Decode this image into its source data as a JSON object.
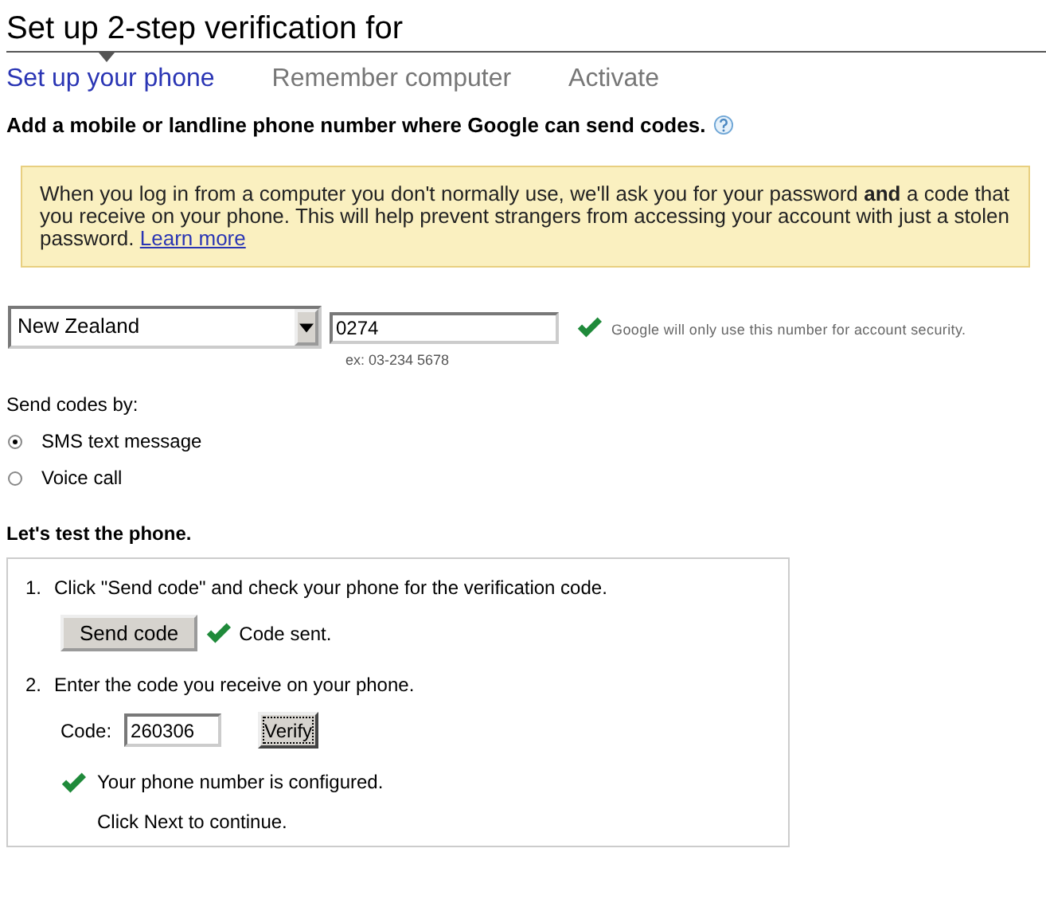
{
  "title": "Set up 2-step verification for",
  "steps": [
    {
      "label": "Set up your phone",
      "selected": true
    },
    {
      "label": "Remember computer",
      "selected": false
    },
    {
      "label": "Activate",
      "selected": false
    }
  ],
  "heading": "Add a mobile or landline phone number where Google can send codes.",
  "notice": {
    "text": "When you log in from a computer you don't normally use, we'll ask you for your password **and** a code that you receive on your phone. This will help prevent strangers from accessing your account with just a stolen password.",
    "link": "Learn more"
  },
  "phone": {
    "country": "New Zealand",
    "number": "0274",
    "valid": true,
    "note": "Google will only use this number for account security.",
    "example": "ex: 03-234 5678"
  },
  "send_by": {
    "label": "Send codes by:",
    "options": [
      {
        "label": "SMS text message",
        "selected": true
      },
      {
        "label": "Voice call",
        "selected": false
      }
    ]
  },
  "test": {
    "heading": "Let's test the phone.",
    "items": [
      {
        "kind": "send",
        "number": "1.",
        "text": "Click \"Send code\" and check your phone for the verification code.",
        "button": "Send code",
        "status": "Code sent."
      },
      {
        "kind": "verify",
        "number": "2.",
        "text": "Enter the code you receive on your phone.",
        "code_label": "Code:",
        "code": "260306",
        "button": "Verify",
        "button_focused": true,
        "result": "Your phone number is configured.",
        "next": "Click Next to continue."
      }
    ]
  }
}
